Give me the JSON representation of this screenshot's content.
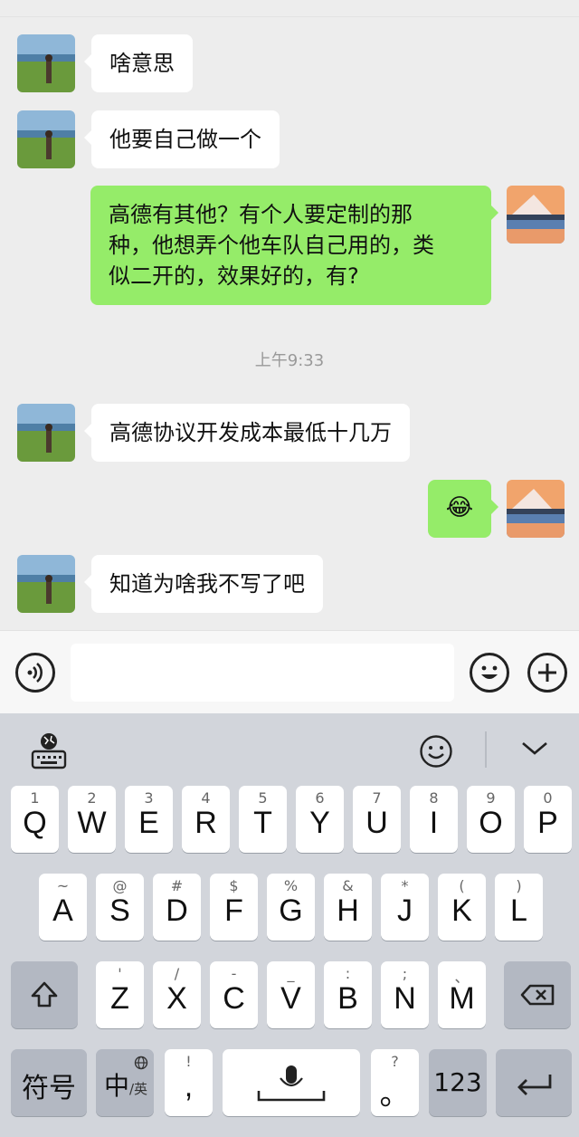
{
  "chat": {
    "messages": [
      {
        "side": "in",
        "text": "啥意思"
      },
      {
        "side": "in",
        "text": "他要自己做一个"
      },
      {
        "side": "out",
        "text": "高德有其他？有个人要定制的那\n种，他想弄个他车队自己用的，类\n似二开的，效果好的，有?"
      },
      {
        "side": "in",
        "text": "高德协议开发成本最低十几万"
      },
      {
        "side": "out",
        "text": "😂"
      },
      {
        "side": "in",
        "text": "知道为啥我不写了吧"
      }
    ],
    "timestamp": "上午9:33"
  },
  "input_bar": {
    "voice_icon": "voice-icon",
    "emoji_icon": "emoji-icon",
    "plus_icon": "plus-icon"
  },
  "keyboard": {
    "toolbar": {
      "left_icon": "keyboard-settings-icon",
      "emoji_icon": "smile-icon",
      "collapse_icon": "chevron-down-icon"
    },
    "row1": [
      {
        "sym": "1",
        "label": "Q"
      },
      {
        "sym": "2",
        "label": "W"
      },
      {
        "sym": "3",
        "label": "E"
      },
      {
        "sym": "4",
        "label": "R"
      },
      {
        "sym": "5",
        "label": "T"
      },
      {
        "sym": "6",
        "label": "Y"
      },
      {
        "sym": "7",
        "label": "U"
      },
      {
        "sym": "8",
        "label": "I"
      },
      {
        "sym": "9",
        "label": "O"
      },
      {
        "sym": "0",
        "label": "P"
      }
    ],
    "row2": [
      {
        "sym": "~",
        "label": "A"
      },
      {
        "sym": "@",
        "label": "S"
      },
      {
        "sym": "#",
        "label": "D"
      },
      {
        "sym": "$",
        "label": "F"
      },
      {
        "sym": "%",
        "label": "G"
      },
      {
        "sym": "&",
        "label": "H"
      },
      {
        "sym": "*",
        "label": "J"
      },
      {
        "sym": "(",
        "label": "K"
      },
      {
        "sym": ")",
        "label": "L"
      }
    ],
    "row3": [
      {
        "sym": "'",
        "label": "Z"
      },
      {
        "sym": "/",
        "label": "X"
      },
      {
        "sym": "-",
        "label": "C"
      },
      {
        "sym": "_",
        "label": "V"
      },
      {
        "sym": ":",
        "label": "B"
      },
      {
        "sym": ";",
        "label": "N"
      },
      {
        "sym": "、",
        "label": "M"
      }
    ],
    "bottom": {
      "symbols_label": "符号",
      "lang_label": "中",
      "lang_sub": "/英",
      "comma_sym": "!",
      "comma_label": ",",
      "period_sym": "?",
      "period_label": "。",
      "numbers_label": "123"
    }
  }
}
